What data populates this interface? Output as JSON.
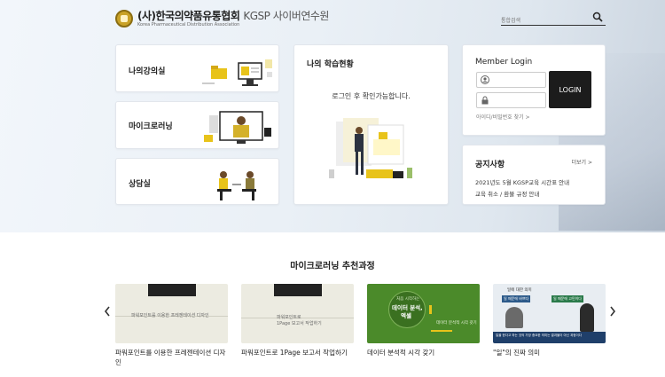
{
  "header": {
    "logo_title": "(사)한국의약품유통협회",
    "logo_kgsp": "KGSP 사이버연수원",
    "logo_subtitle": "Korea Pharmaceutical Distribution Association",
    "search_placeholder": "통합검색"
  },
  "menu": [
    {
      "label": "나의강의실"
    },
    {
      "label": "마이크로러닝"
    },
    {
      "label": "상담실"
    }
  ],
  "learning_status": {
    "title": "나의 학습현황",
    "message": "로그인 후 확인가능합니다."
  },
  "login": {
    "title": "Member Login",
    "button": "LOGIN",
    "find_link": "아이디/비밀번호 찾기 >"
  },
  "notice": {
    "title": "공지사항",
    "more": "더보기 >",
    "items": [
      "2021년도 5월 KGSP교육 시간표 안내",
      "교육 취소 / 환불 규정 안내"
    ]
  },
  "recommend": {
    "title": "마이크로러닝 추천과정",
    "courses": [
      {
        "title": "파워포인트를 이용한 프레젠테이션 디자인",
        "thumb_caption": "파워포인트를 이용한 프레젠테이션 디자인"
      },
      {
        "title": "파워포인트로 1Page 보고서 작업하기",
        "thumb_caption_1": "파워포인트로",
        "thumb_caption_2": "1Page 보고서 작업하기"
      },
      {
        "title": "데이터 분석적 시각 갖기",
        "thumb_small": "처음 시작하는",
        "thumb_main": "데이터 분석,",
        "thumb_main2": "엑셀",
        "thumb_side": "데이터 분석적 시각 갖기"
      },
      {
        "title": "\"일\"의 진짜 의미",
        "thumb_top": "일에 대한 의미",
        "thumb_a": "일 때문에 바쁘다",
        "thumb_b": "일 때문에 고민이다",
        "thumb_bottom": "일을 한다고 하는 것의 가장 중요한 의미는 결과물이 아닌 과정이다"
      }
    ]
  },
  "colors": {
    "login_bg": "#1c1c1c",
    "course3_bg": "#4b8a2a",
    "accent_yellow": "#e8c31a"
  }
}
